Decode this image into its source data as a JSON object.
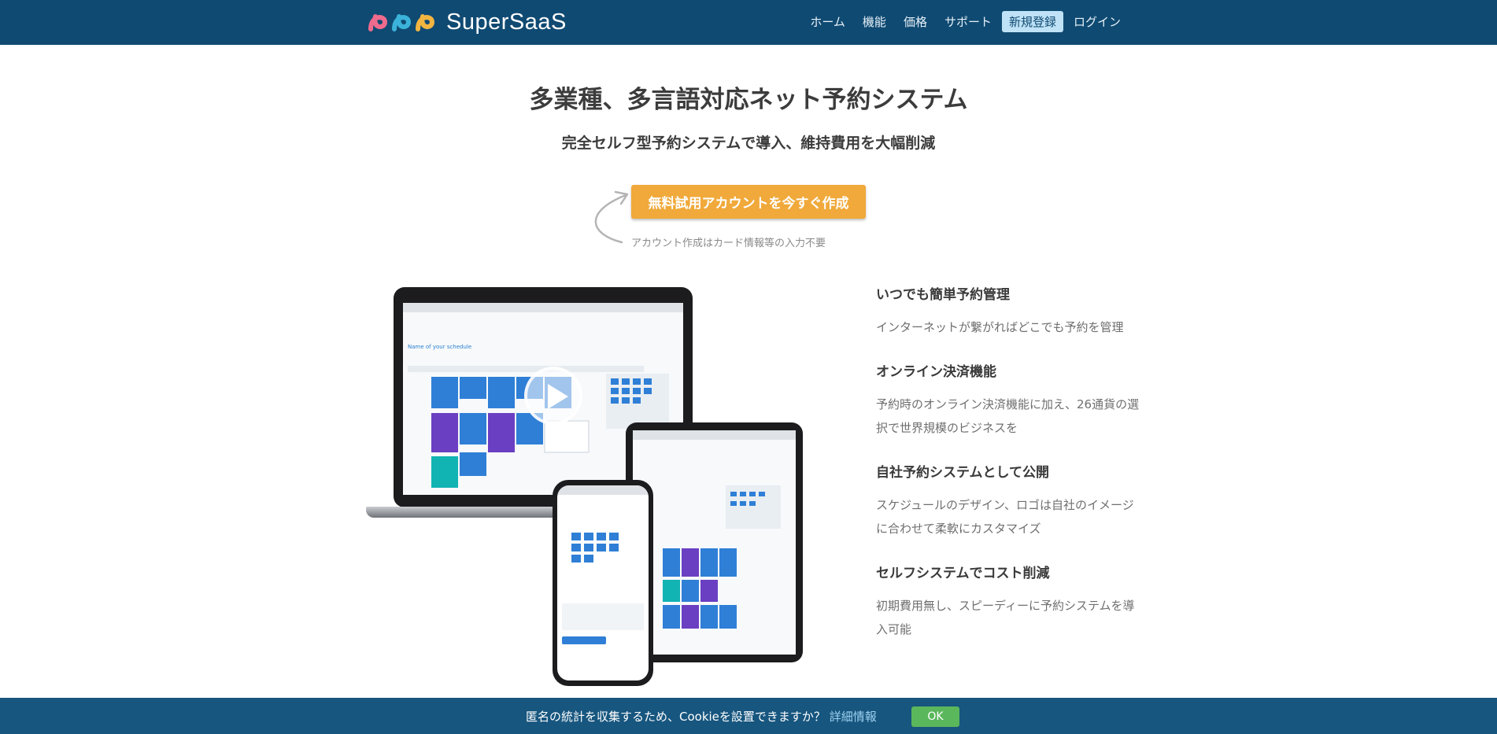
{
  "header": {
    "brand": "SuperSaaS",
    "nav": [
      "ホーム",
      "機能",
      "価格",
      "サポート",
      "新規登録",
      "ログイン"
    ]
  },
  "hero": {
    "title": "多業種、多言語対応ネット予約システム",
    "subtitle": "完全セルフ型予約システムで導入、維持費用を大幅削減",
    "cta_label": "無料試用アカウントを今すぐ作成",
    "cta_note": "アカウント作成はカード情報等の入力不要"
  },
  "devices": {
    "schedule_title": "Name of your schedule",
    "play_icon": "play-icon"
  },
  "features": [
    {
      "title": "いつでも簡単予約管理",
      "text": "インターネットが繋がればどこでも予約を管理"
    },
    {
      "title": "オンライン決済機能",
      "text": "予約時のオンライン決済機能に加え、26通貨の選択で世界規模のビジネスを"
    },
    {
      "title": "自社予約システムとして公開",
      "text": "スケジュールのデザイン、ロゴは自社のイメージに合わせて柔軟にカスタマイズ"
    },
    {
      "title": "セルフシステムでコスト削減",
      "text": "初期費用無し、スピーディーに予約システムを導入可能"
    }
  ],
  "cookie": {
    "text": "匿名の統計を収集するため、Cookieを設置できますか？",
    "link": "詳細情報",
    "ok": "OK"
  },
  "colors": {
    "header_bg": "#0f4a72",
    "cta": "#f0a93a",
    "cookie_bg": "#17567f",
    "ok_button": "#5bb75b"
  }
}
